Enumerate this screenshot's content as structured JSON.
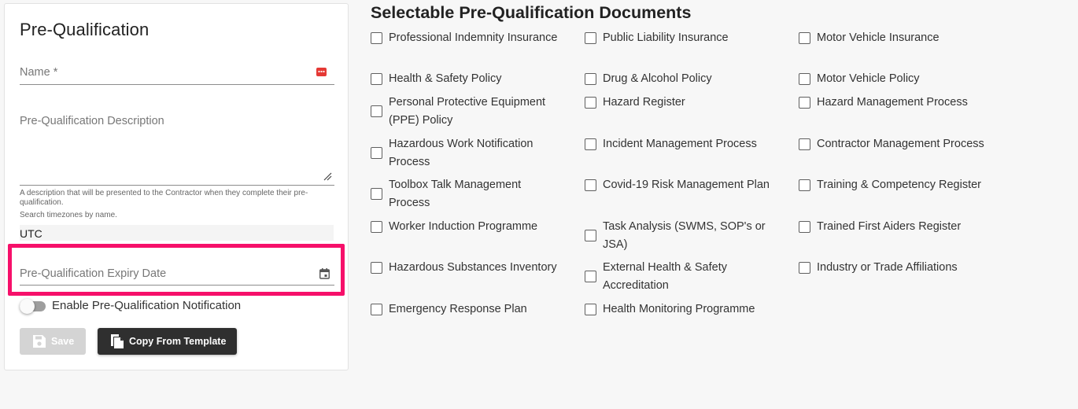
{
  "form": {
    "title": "Pre-Qualification",
    "name_label": "Name *",
    "description_label": "Pre-Qualification Description",
    "description_hint": "A description that will be presented to the Contractor when they complete their pre-qualification.",
    "timezone_hint": "Search timezones by name.",
    "timezone_value": "UTC",
    "expiry_label": "Pre-Qualification Expiry Date",
    "notification_label": "Enable Pre-Qualification Notification",
    "notification_enabled": false,
    "save_label": "Save",
    "copy_label": "Copy From Template"
  },
  "documents": {
    "title": "Selectable Pre-Qualification Documents",
    "columns": [
      [
        "Professional Indemnity Insurance",
        "Health & Safety Policy",
        "Personal Protective Equipment (PPE) Policy",
        "Hazardous Work Notification Process",
        "Toolbox Talk Management Process",
        "Worker Induction Programme",
        "Hazardous Substances Inventory",
        "Emergency Response Plan"
      ],
      [
        "Public Liability Insurance",
        "Drug & Alcohol Policy",
        "Hazard Register",
        "Incident Management Process",
        "Covid-19 Risk Management Plan",
        "Task Analysis (SWMS, SOP's or JSA)",
        "External Health & Safety Accreditation",
        "Health Monitoring Programme"
      ],
      [
        "Motor Vehicle Insurance",
        "Motor Vehicle Policy",
        "Hazard Management Process",
        "Contractor Management Process",
        "Training & Competency Register",
        "Trained First Aiders Register",
        "Industry or Trade Affiliations"
      ]
    ]
  },
  "colors": {
    "highlight": "#f6106a",
    "required_icon": "#e53935",
    "copy_button": "#2f2f2f",
    "save_button_disabled": "#d4d4d4"
  }
}
